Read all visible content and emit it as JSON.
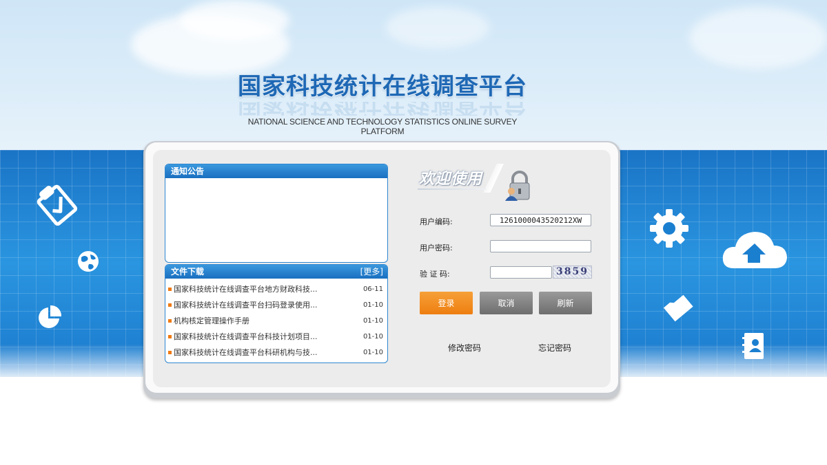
{
  "title": {
    "cn": "国家科技统计在线调查平台",
    "en": "NATIONAL SCIENCE AND TECHNOLOGY STATISTICS ONLINE SURVEY PLATFORM"
  },
  "notice": {
    "header": "通知公告"
  },
  "downloads": {
    "header": "文件下载",
    "more": "[更多]",
    "items": [
      {
        "title": "国家科技统计在线调查平台地方财政科技...",
        "date": "06-11"
      },
      {
        "title": "国家科技统计在线调查平台扫码登录使用...",
        "date": "01-10"
      },
      {
        "title": "机构核定管理操作手册",
        "date": "01-10"
      },
      {
        "title": "国家科技统计在线调查平台科技计划项目...",
        "date": "01-10"
      },
      {
        "title": "国家科技统计在线调查平台科研机构与技...",
        "date": "01-10"
      }
    ]
  },
  "login": {
    "welcome": "欢迎使用",
    "user_code_label": "用户编码:",
    "user_code_value": "1261000043520212XW",
    "password_label": "用户密码:",
    "password_value": "",
    "captcha_label": "验 证 码:",
    "captcha_value": "",
    "captcha_image_text": "3859",
    "login_button": "登录",
    "cancel_button": "取消",
    "refresh_button": "刷新",
    "change_password_link": "修改密码",
    "forgot_password_link": "忘记密码"
  },
  "colors": {
    "brand_blue": "#1e68b5",
    "band_blue": "#1b7fd0",
    "login_orange": "#ee7e10",
    "button_gray": "#7a7a7a"
  },
  "icons": [
    "clipboard-icon",
    "globe-icon",
    "pie-chart-icon",
    "gear-icon",
    "cloud-upload-icon",
    "folder-icon",
    "contacts-book-icon",
    "lock-user-icon"
  ]
}
